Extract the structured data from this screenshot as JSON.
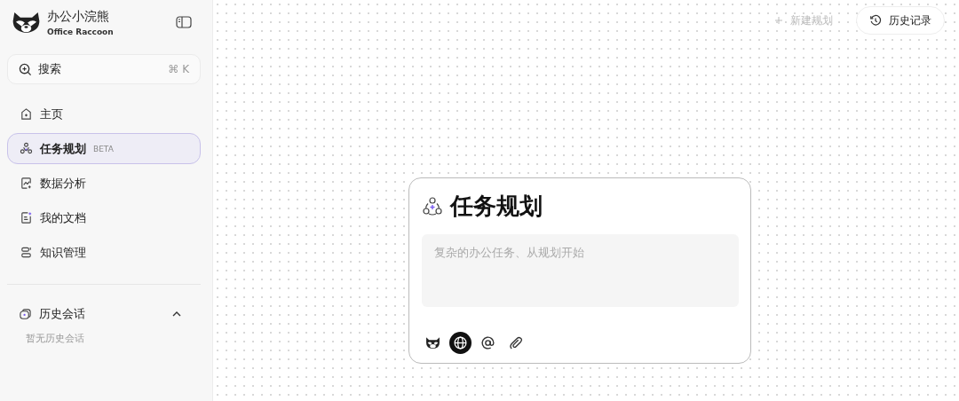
{
  "brand": {
    "name": "办公小浣熊",
    "subtitle": "Office Raccoon"
  },
  "search": {
    "label": "搜索",
    "shortcut": "⌘ K"
  },
  "nav": [
    {
      "kind": "home",
      "label": "主页",
      "selected": false
    },
    {
      "kind": "tasks",
      "label": "任务规划",
      "badge": "BETA",
      "selected": true
    },
    {
      "kind": "chart",
      "label": "数据分析",
      "selected": false
    },
    {
      "kind": "doc",
      "label": "我的文档",
      "selected": false
    },
    {
      "kind": "knowledge",
      "label": "知识管理",
      "selected": false
    }
  ],
  "history": {
    "label": "历史会话",
    "expanded": true,
    "empty_text": "暂无历史会话"
  },
  "topbar": {
    "new_label": "新建规划",
    "history_label": "历史记录"
  },
  "card": {
    "title": "任务规划",
    "placeholder": "复杂的办公任务、从规划开始",
    "tools": [
      {
        "kind": "raccoon",
        "on": false
      },
      {
        "kind": "globe",
        "on": true
      },
      {
        "kind": "mention",
        "on": false
      },
      {
        "kind": "attach",
        "on": false
      }
    ]
  }
}
